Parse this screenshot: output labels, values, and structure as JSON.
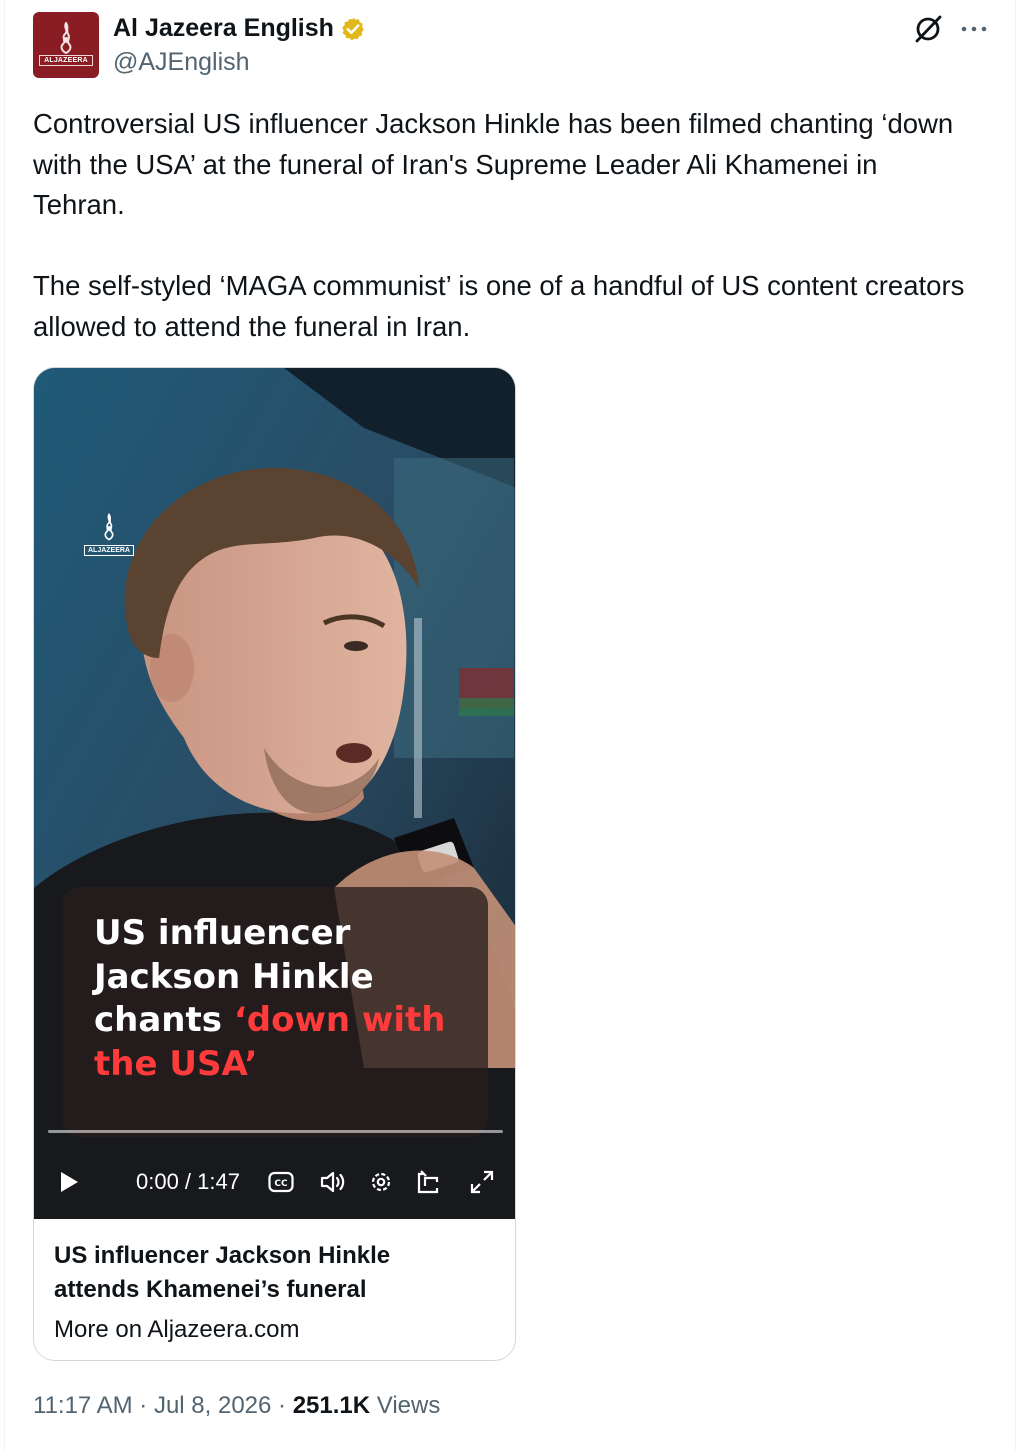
{
  "author": {
    "display_name": "Al Jazeera English",
    "handle": "@AJEnglish",
    "verified": true,
    "avatar_wordmark": "ALJAZEERA",
    "avatar_color": "#8a1c24",
    "verified_color": "#e2b719"
  },
  "icons": {
    "grok": "grok-icon",
    "more": "more-horizontal-icon",
    "verified": "verified-badge-icon"
  },
  "tweet": {
    "paragraphs": [
      "Controversial US influencer Jackson Hinkle has been filmed chanting ‘down with the USA’ at the funeral of Iran's Supreme Leader Ali Khamenei in Tehran.",
      "The self-styled ‘MAGA communist’ is one of a handful of US content creators allowed to attend the funeral in Iran."
    ]
  },
  "media": {
    "watermark": "ALJAZEERA",
    "caption_white": "US influencer Jackson Hinkle chants ",
    "caption_red": "‘down with the USA’",
    "caption_red_color": "#ff3b3b",
    "progress_percent": 0,
    "controls": {
      "time": "0:00 / 1:47",
      "play": "play-icon",
      "captions": "closed-captions-icon",
      "volume": "volume-icon",
      "settings": "settings-gear-icon",
      "dock": "picture-in-picture-icon",
      "fullscreen": "fullscreen-expand-icon"
    }
  },
  "link_card": {
    "title": "US influencer Jackson Hinkle attends Khamenei’s funeral",
    "source": "More on Aljazeera.com"
  },
  "meta": {
    "time": "11:17 AM",
    "sep1": " · ",
    "date": "Jul 8, 2026",
    "sep2": " · ",
    "views_count": "251.1K",
    "views_label": " Views"
  }
}
